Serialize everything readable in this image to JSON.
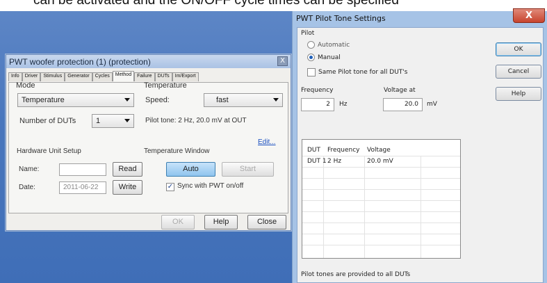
{
  "background": {
    "top_text": "can be activated and the ON/OFF cycle times can be specified"
  },
  "left_window": {
    "title": "PWT woofer protection (1) (protection)",
    "close_label": "X",
    "tabs": [
      "Info",
      "Driver",
      "Stimulus",
      "Generator",
      "Cycles",
      "Method",
      "Failure",
      "DUTs",
      "Im/Export"
    ],
    "active_tab": "Method",
    "mode": {
      "group_label": "Mode",
      "selected": "Temperature",
      "dut_count_label": "Number of DUTs",
      "dut_count_value": "1"
    },
    "temperature": {
      "group_label": "Temperature",
      "speed_label": "Speed:",
      "speed_value": "fast",
      "pilot_tone_text": "Pilot tone: 2 Hz, 20.0 mV at OUT",
      "edit_link": "Edit..."
    },
    "hardware": {
      "group_label": "Hardware Unit Setup",
      "name_label": "Name:",
      "name_value": "",
      "read_button": "Read",
      "date_label": "Date:",
      "date_value": "2011-06-22",
      "write_button": "Write"
    },
    "temp_window": {
      "group_label": "Temperature Window",
      "auto_button": "Auto",
      "start_button": "Start",
      "sync_label": "Sync with PWT on/off",
      "sync_checked": true
    },
    "footer": {
      "ok": "OK",
      "help": "Help",
      "close": "Close"
    }
  },
  "dialog": {
    "title": "PWT Pilot Tone Settings",
    "close_label": "X",
    "pilot_group": "Pilot",
    "radio_automatic": "Automatic",
    "radio_manual": "Manual",
    "selected_mode": "Manual",
    "same_tone_label": "Same Pilot tone for all DUT's",
    "same_tone_checked": false,
    "frequency_label": "Frequency",
    "frequency_value": "2",
    "frequency_unit": "Hz",
    "voltage_label": "Voltage at",
    "voltage_value": "20.0",
    "voltage_unit": "mV",
    "buttons": {
      "ok": "OK",
      "cancel": "Cancel",
      "help": "Help"
    },
    "table": {
      "columns": [
        "DUT",
        "Frequency",
        "Voltage"
      ],
      "rows": [
        [
          "DUT 1",
          "2 Hz",
          "20.0 mV"
        ]
      ]
    },
    "footer_text": "Pilot tones are provided to all DUTs"
  }
}
